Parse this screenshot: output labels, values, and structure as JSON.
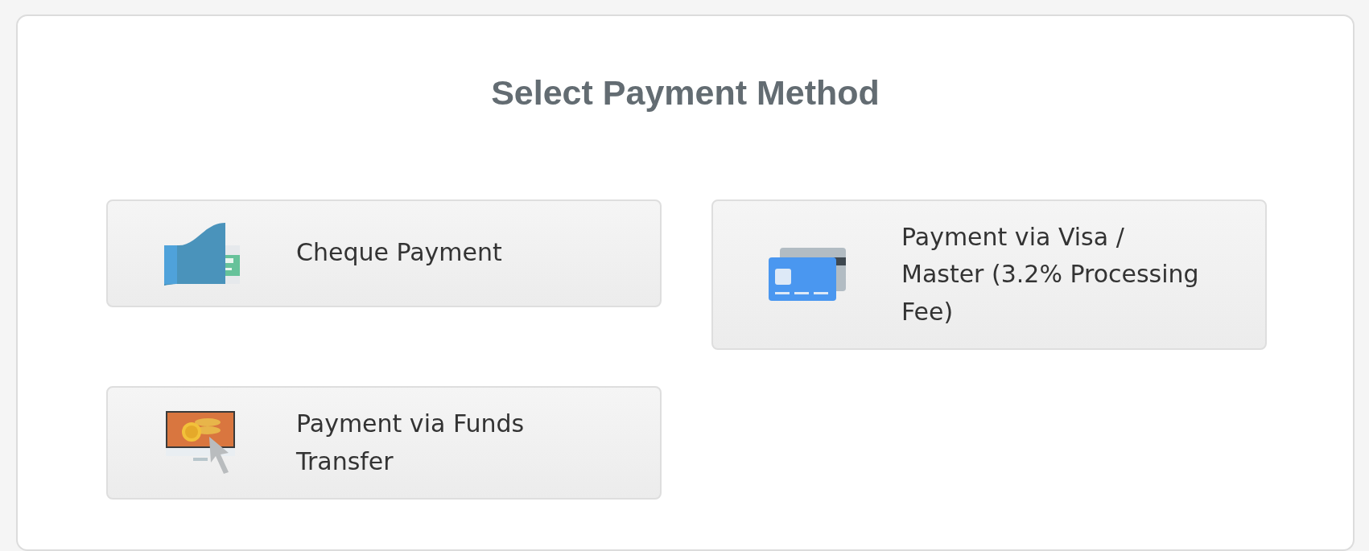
{
  "title": "Select Payment Method",
  "methods": [
    {
      "label": "Cheque Payment",
      "kind": "cheque"
    },
    {
      "label": "Payment via Visa / Master (3.2% Processing Fee)",
      "kind": "card"
    },
    {
      "label": "Payment via Funds Transfer",
      "kind": "transfer"
    }
  ]
}
